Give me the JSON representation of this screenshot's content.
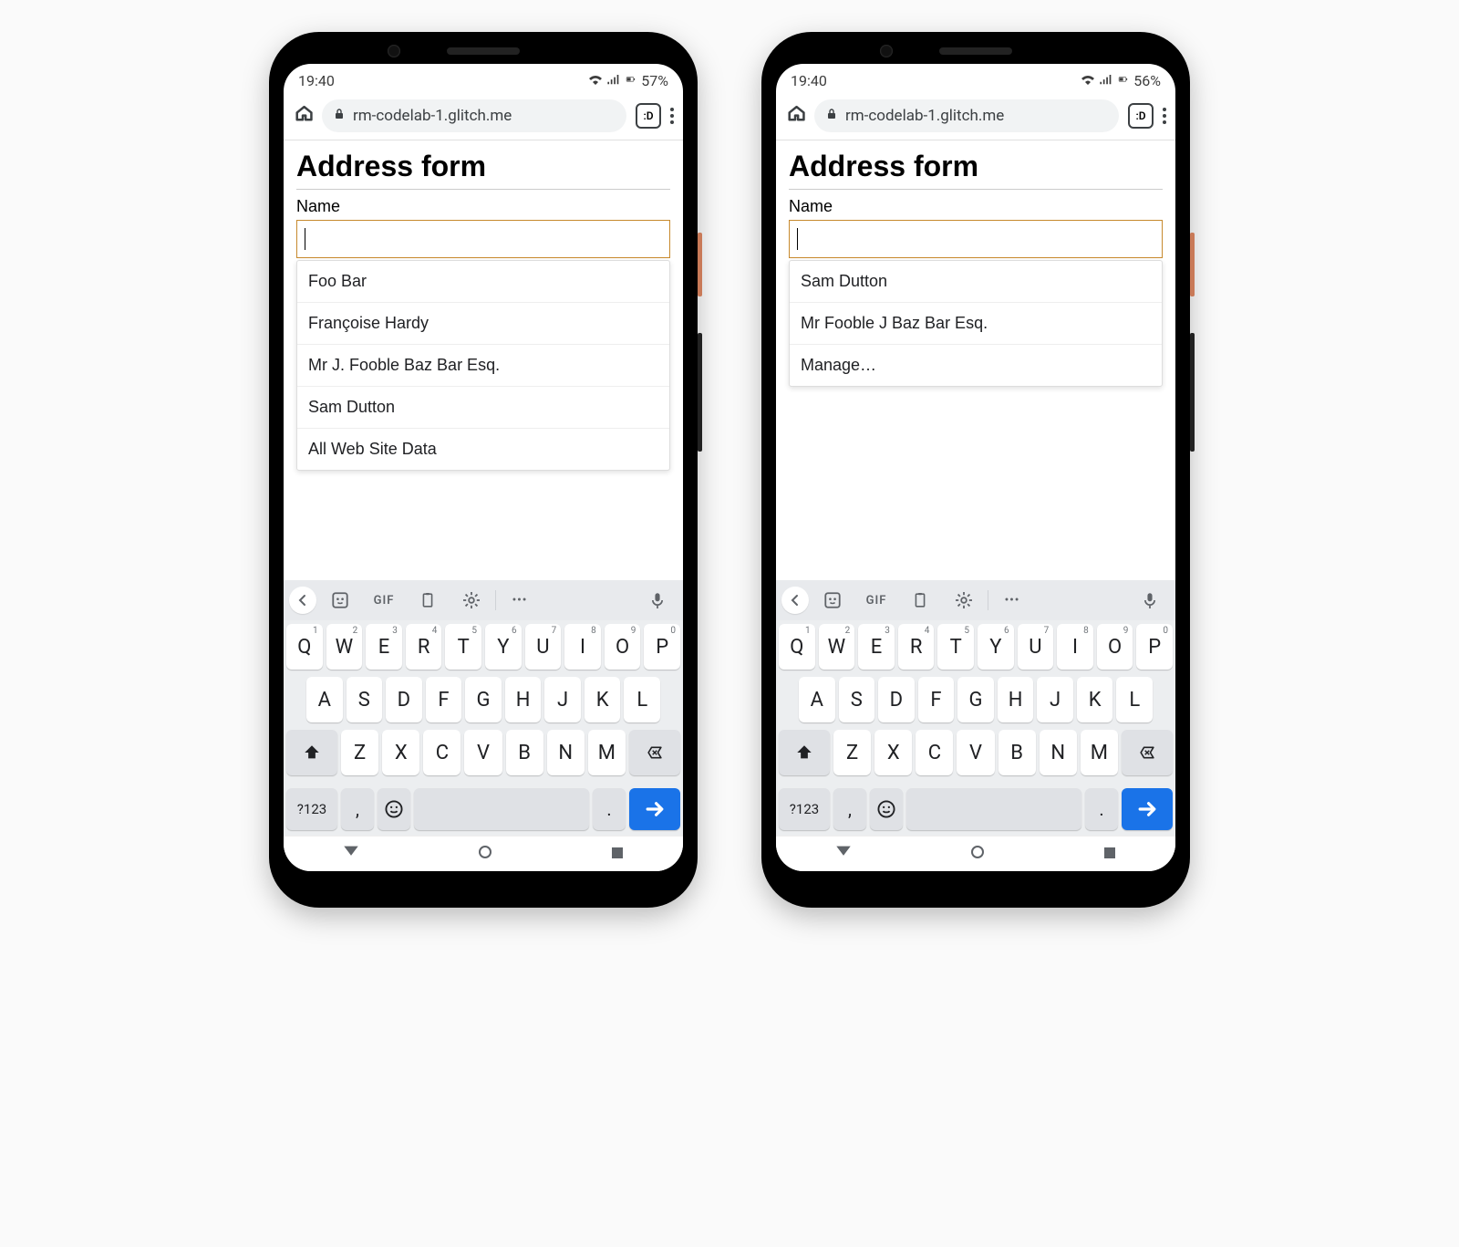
{
  "phones": [
    {
      "status": {
        "time": "19:40",
        "battery_pct": "57%"
      },
      "browser": {
        "url": "rm-codelab-1.glitch.me",
        "tabs_badge": ":D"
      },
      "page": {
        "title": "Address form",
        "field_label": "Name",
        "input_value": "",
        "suggestions": [
          "Foo Bar",
          "Françoise Hardy",
          "Mr J. Fooble Baz Bar Esq.",
          "Sam Dutton",
          "All Web Site Data"
        ]
      }
    },
    {
      "status": {
        "time": "19:40",
        "battery_pct": "56%"
      },
      "browser": {
        "url": "rm-codelab-1.glitch.me",
        "tabs_badge": ":D"
      },
      "page": {
        "title": "Address form",
        "field_label": "Name",
        "input_value": "",
        "suggestions": [
          "Sam Dutton",
          "Mr Fooble J Baz Bar Esq.",
          "Manage…"
        ]
      }
    }
  ],
  "keyboard": {
    "row1": [
      {
        "k": "Q",
        "h": "1"
      },
      {
        "k": "W",
        "h": "2"
      },
      {
        "k": "E",
        "h": "3"
      },
      {
        "k": "R",
        "h": "4"
      },
      {
        "k": "T",
        "h": "5"
      },
      {
        "k": "Y",
        "h": "6"
      },
      {
        "k": "U",
        "h": "7"
      },
      {
        "k": "I",
        "h": "8"
      },
      {
        "k": "O",
        "h": "9"
      },
      {
        "k": "P",
        "h": "0"
      }
    ],
    "row2": [
      "A",
      "S",
      "D",
      "F",
      "G",
      "H",
      "J",
      "K",
      "L"
    ],
    "row3": [
      "Z",
      "X",
      "C",
      "V",
      "B",
      "N",
      "M"
    ],
    "switch_label": "?123",
    "gif_label": "GIF"
  }
}
